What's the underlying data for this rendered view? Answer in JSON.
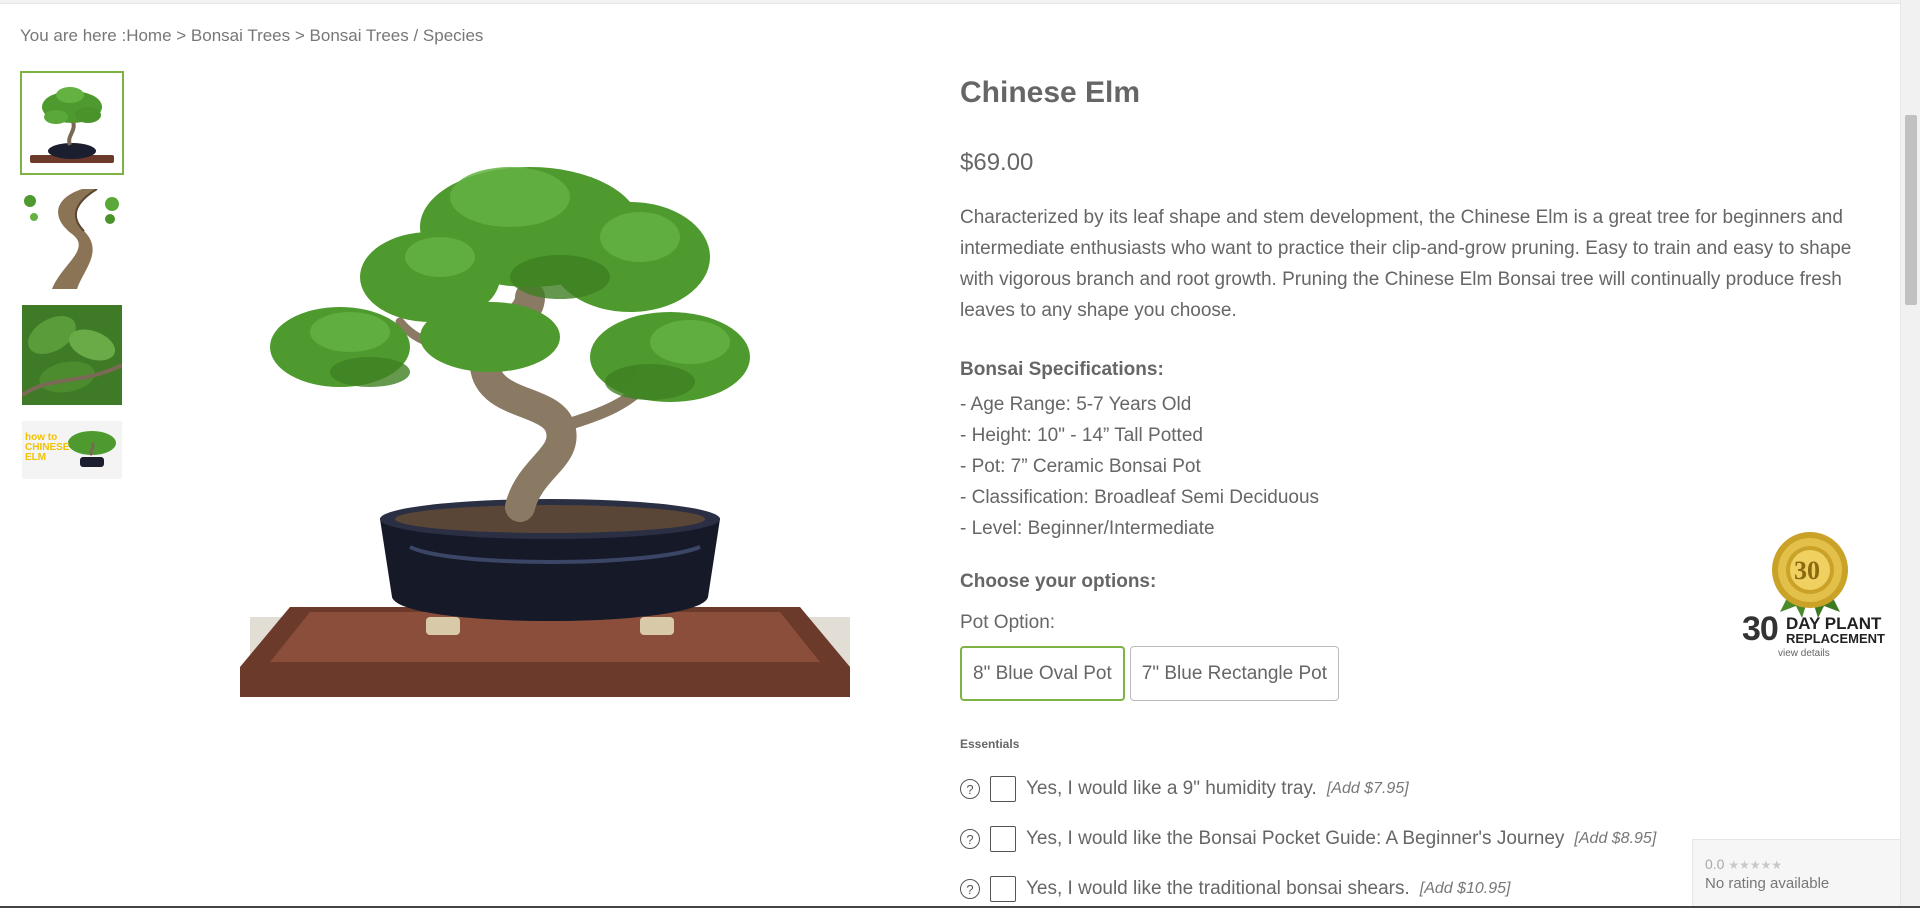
{
  "breadcrumb": {
    "prefix": "You are here :",
    "items": [
      "Home",
      "Bonsai Trees",
      "Bonsai Trees / Species"
    ],
    "separator": " > "
  },
  "gallery": {
    "thumbnails": [
      {
        "name": "bonsai-in-oval-pot"
      },
      {
        "name": "twisted-trunk-closeup"
      },
      {
        "name": "leaf-closeup"
      },
      {
        "name": "how-to-chinese-elm"
      }
    ],
    "thumbnail_4_text": "how to CHINESE ELM",
    "active_index": 0
  },
  "product": {
    "title": "Chinese Elm",
    "price": "$69.00",
    "description": "Characterized by its leaf shape and stem development, the Chinese Elm is a great tree for beginners and intermediate enthusiasts who want to practice their clip-and-grow pruning. Easy to train and easy to shape with vigorous branch and root growth. Pruning the Chinese Elm Bonsai tree will continually produce fresh leaves to any shape you choose.",
    "spec_heading": "Bonsai Specifications:",
    "specs": [
      "- Age Range: 5-7 Years Old",
      "- Height: 10\" - 14” Tall Potted",
      "- Pot: 7” Ceramic Bonsai Pot",
      "- Classification: Broadleaf Semi Deciduous",
      "- Level: Beginner/Intermediate"
    ],
    "options_heading": "Choose your options:",
    "pot_option_label": "Pot Option:",
    "pot_options": [
      "8\" Blue Oval Pot",
      "7\" Blue Rectangle Pot"
    ],
    "pot_selected_index": 0,
    "essentials_heading": "Essentials",
    "essentials": [
      {
        "label": "Yes, I would like a 9\" humidity tray.",
        "add": "[Add $7.95]"
      },
      {
        "label": "Yes, I would like the Bonsai Pocket Guide: A Beginner's Journey",
        "add": "[Add $8.95]"
      },
      {
        "label": "Yes, I would like the traditional bonsai shears.",
        "add": "[Add $10.95]"
      }
    ],
    "help_glyph": "?"
  },
  "badge": {
    "number": "30",
    "line1": "DAY PLANT",
    "line2": "REPLACEMENT",
    "link": "view details"
  },
  "rating_widget": {
    "score": "0.0",
    "stars": "★★★★★",
    "text": "No rating available"
  },
  "colors": {
    "accent": "#7cb342",
    "text": "#666666",
    "gold": "#c9a227"
  }
}
